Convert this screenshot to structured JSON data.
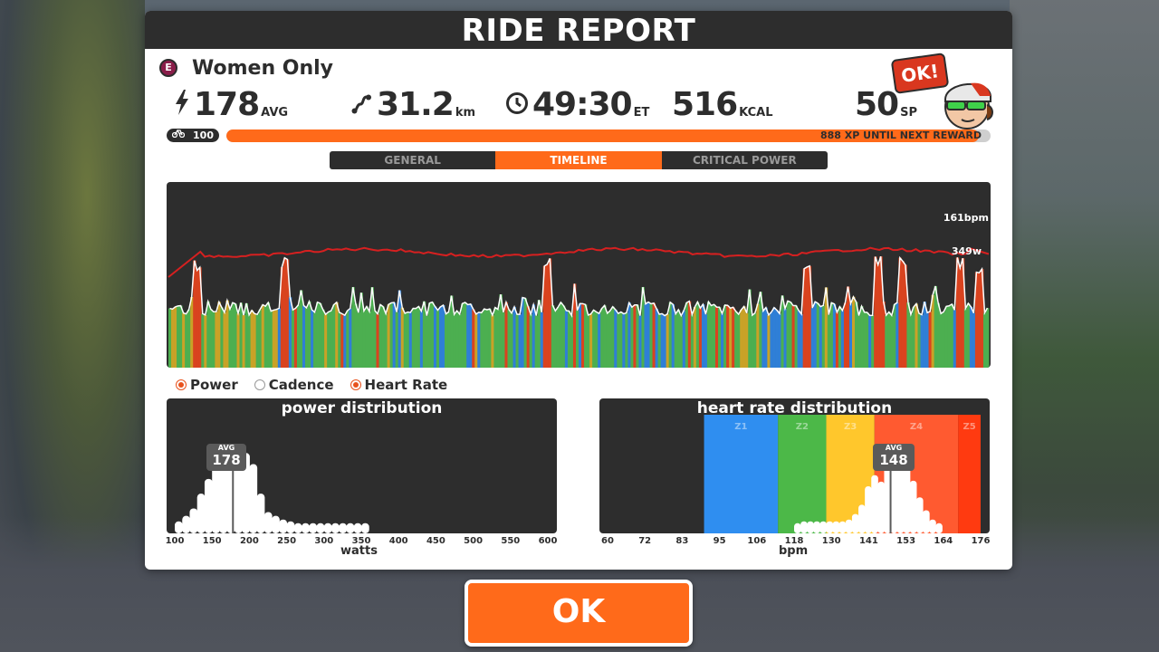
{
  "title": "RIDE REPORT",
  "event": {
    "badge": "E",
    "name": "Women Only"
  },
  "stats": {
    "power": {
      "value": "178",
      "unit": "AVG"
    },
    "distance": {
      "value": "31.2",
      "unit": "km"
    },
    "time": {
      "value": "49:30",
      "unit": "ET"
    },
    "calories": {
      "value": "516",
      "unit": "KCAL"
    },
    "sport_points": {
      "value": "50",
      "unit": "SP"
    }
  },
  "ok_sticker": "OK!",
  "level": {
    "value": "100",
    "xp_text": "888 XP UNTIL NEXT REWARD",
    "progress": 0.985
  },
  "tabs": [
    {
      "label": "GENERAL",
      "active": false
    },
    {
      "label": "TIMELINE",
      "active": true
    },
    {
      "label": "CRITICAL POWER",
      "active": false
    }
  ],
  "timeline": {
    "hr_label": "161bpm",
    "power_label": "349w",
    "colors": {
      "hr": "#d62020",
      "power_line": "#ffffff",
      "z1": "#7a7a7a",
      "z2": "#2f7fd6",
      "z3": "#4caf50",
      "z4": "#c9a227",
      "z5": "#d9431f"
    }
  },
  "legend": [
    {
      "label": "Power",
      "on": true
    },
    {
      "label": "Cadence",
      "on": false
    },
    {
      "label": "Heart Rate",
      "on": true
    }
  ],
  "chart_data": [
    {
      "type": "bar",
      "title": "power distribution",
      "xlabel": "watts",
      "x_ticks": [
        "100",
        "150",
        "200",
        "250",
        "300",
        "350",
        "400",
        "450",
        "500",
        "550",
        "600"
      ],
      "avg_label": "AVG",
      "avg_value": "178",
      "xlim": [
        100,
        600
      ],
      "bins": [
        100,
        110,
        120,
        130,
        140,
        150,
        160,
        170,
        180,
        190,
        200,
        210,
        220,
        230,
        240,
        250,
        260,
        270,
        280,
        290,
        300,
        310,
        320,
        330,
        340,
        350
      ],
      "values": [
        0.12,
        0.18,
        0.26,
        0.42,
        0.58,
        0.76,
        0.92,
        0.95,
        0.9,
        0.86,
        0.74,
        0.42,
        0.22,
        0.18,
        0.14,
        0.12,
        0.1,
        0.1,
        0.1,
        0.1,
        0.1,
        0.1,
        0.1,
        0.1,
        0.1,
        0.1
      ]
    },
    {
      "type": "bar",
      "title": "heart rate distribution",
      "xlabel": "bpm",
      "x_ticks": [
        "60",
        "72",
        "83",
        "95",
        "106",
        "118",
        "130",
        "141",
        "153",
        "164",
        "176"
      ],
      "avg_label": "AVG",
      "avg_value": "148",
      "xlim": [
        60,
        176
      ],
      "zones": [
        {
          "label": "Z1",
          "from": 90,
          "to": 113,
          "color": "#2f8ef0"
        },
        {
          "label": "Z2",
          "from": 113,
          "to": 128,
          "color": "#4cb848"
        },
        {
          "label": "Z3",
          "from": 128,
          "to": 143,
          "color": "#ffc72c"
        },
        {
          "label": "Z4",
          "from": 143,
          "to": 169,
          "color": "#ff5a30"
        },
        {
          "label": "Z5",
          "from": 169,
          "to": 176,
          "color": "#ff3a10"
        }
      ],
      "bins": [
        118,
        120,
        122,
        124,
        126,
        128,
        130,
        132,
        134,
        136,
        138,
        140,
        142,
        144,
        146,
        148,
        150,
        152,
        154,
        156,
        158,
        160,
        162
      ],
      "values": [
        0.1,
        0.12,
        0.12,
        0.12,
        0.12,
        0.12,
        0.12,
        0.12,
        0.14,
        0.2,
        0.3,
        0.5,
        0.62,
        0.55,
        0.7,
        0.82,
        0.86,
        0.72,
        0.56,
        0.38,
        0.24,
        0.14,
        0.1
      ]
    }
  ],
  "ok_button": "OK"
}
